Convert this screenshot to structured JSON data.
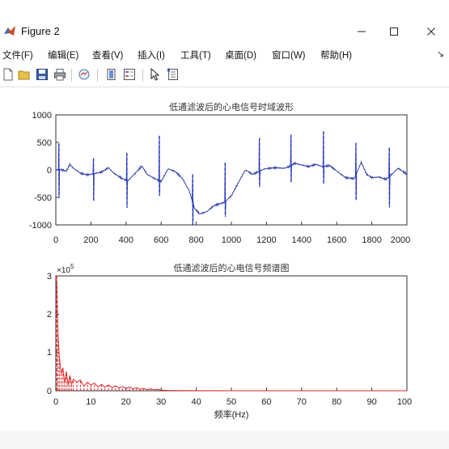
{
  "window": {
    "title": "Figure 2"
  },
  "menu": [
    "文件(F)",
    "编辑(E)",
    "查看(V)",
    "插入(I)",
    "工具(T)",
    "桌面(D)",
    "窗口(W)",
    "帮助(H)"
  ],
  "toolbar_icons": [
    "new-figure-icon",
    "open-file-icon",
    "save-icon",
    "print-icon",
    "link-plot-icon",
    "insert-colorbar-icon",
    "insert-legend-icon",
    "select-arrow-icon",
    "property-editor-icon"
  ],
  "chart_data": [
    {
      "type": "line",
      "title": "低通滤波后的心电信号时域波形",
      "xlabel": "",
      "ylabel": "",
      "xlim": [
        0,
        2000
      ],
      "ylim": [
        -1000,
        1000
      ],
      "xticks": [
        "0",
        "200",
        "400",
        "600",
        "800",
        "1000",
        "1200",
        "1400",
        "1600",
        "1800",
        "2000"
      ],
      "yticks": [
        "1000",
        "500",
        "0",
        "-500",
        "-1000"
      ],
      "baseline": [
        [
          0,
          0
        ],
        [
          20,
          10
        ],
        [
          60,
          -20
        ],
        [
          80,
          100
        ],
        [
          100,
          30
        ],
        [
          140,
          -60
        ],
        [
          180,
          -90
        ],
        [
          215,
          -70
        ],
        [
          260,
          -40
        ],
        [
          300,
          40
        ],
        [
          330,
          -60
        ],
        [
          380,
          -160
        ],
        [
          410,
          -200
        ],
        [
          450,
          -70
        ],
        [
          490,
          70
        ],
        [
          520,
          -80
        ],
        [
          570,
          -170
        ],
        [
          600,
          -210
        ],
        [
          640,
          20
        ],
        [
          680,
          -30
        ],
        [
          720,
          -150
        ],
        [
          760,
          -380
        ],
        [
          790,
          -700
        ],
        [
          820,
          -800
        ],
        [
          860,
          -760
        ],
        [
          900,
          -650
        ],
        [
          960,
          -590
        ],
        [
          1000,
          -470
        ],
        [
          1050,
          -170
        ],
        [
          1080,
          0
        ],
        [
          1120,
          -80
        ],
        [
          1150,
          -40
        ],
        [
          1190,
          20
        ],
        [
          1250,
          40
        ],
        [
          1300,
          30
        ],
        [
          1330,
          60
        ],
        [
          1360,
          120
        ],
        [
          1400,
          90
        ],
        [
          1440,
          60
        ],
        [
          1480,
          100
        ],
        [
          1520,
          60
        ],
        [
          1560,
          80
        ],
        [
          1600,
          -20
        ],
        [
          1650,
          -140
        ],
        [
          1700,
          -160
        ],
        [
          1740,
          140
        ],
        [
          1770,
          -80
        ],
        [
          1800,
          -140
        ],
        [
          1840,
          -130
        ],
        [
          1880,
          -170
        ],
        [
          1900,
          -120
        ],
        [
          1950,
          30
        ],
        [
          2000,
          -80
        ]
      ],
      "r_peaks": [
        {
          "x": 18,
          "top": 480,
          "bottom": -510
        },
        {
          "x": 215,
          "top": 210,
          "bottom": -560
        },
        {
          "x": 405,
          "top": 310,
          "bottom": -690
        },
        {
          "x": 590,
          "top": 620,
          "bottom": -470
        },
        {
          "x": 780,
          "top": -80,
          "bottom": -1000
        },
        {
          "x": 965,
          "top": 130,
          "bottom": -850
        },
        {
          "x": 1160,
          "top": 580,
          "bottom": -310
        },
        {
          "x": 1340,
          "top": 640,
          "bottom": -230
        },
        {
          "x": 1525,
          "top": 700,
          "bottom": -250
        },
        {
          "x": 1710,
          "top": 490,
          "bottom": -550
        },
        {
          "x": 1900,
          "top": 400,
          "bottom": -680
        }
      ]
    },
    {
      "type": "line",
      "title": "低通滤波后的心电信号频谱图",
      "xlabel": "频率(Hz)",
      "ylabel": "",
      "exponent_label": "×10",
      "exponent_power": "5",
      "xlim": [
        0,
        100
      ],
      "ylim": [
        0,
        300000
      ],
      "xticks": [
        "0",
        "10",
        "20",
        "30",
        "40",
        "50",
        "60",
        "70",
        "80",
        "90",
        "100"
      ],
      "yticks": [
        "3",
        "2",
        "1",
        "0"
      ],
      "spectrum": [
        [
          0,
          300000
        ],
        [
          0.3,
          280000
        ],
        [
          0.6,
          150000
        ],
        [
          1.0,
          90000
        ],
        [
          1.5,
          45000
        ],
        [
          2,
          60000
        ],
        [
          2.5,
          20000
        ],
        [
          3,
          50000
        ],
        [
          3.5,
          15000
        ],
        [
          4,
          40000
        ],
        [
          4.5,
          18000
        ],
        [
          5,
          30000
        ],
        [
          6,
          22000
        ],
        [
          7,
          28000
        ],
        [
          8,
          12000
        ],
        [
          9,
          22000
        ],
        [
          10,
          15000
        ],
        [
          11,
          20000
        ],
        [
          12,
          10000
        ],
        [
          13,
          17000
        ],
        [
          14,
          9000
        ],
        [
          15,
          15000
        ],
        [
          16,
          8000
        ],
        [
          17,
          13000
        ],
        [
          18,
          7000
        ],
        [
          19,
          11000
        ],
        [
          20,
          6000
        ],
        [
          21,
          10000
        ],
        [
          22,
          5000
        ],
        [
          23,
          8000
        ],
        [
          24,
          4000
        ],
        [
          25,
          6000
        ],
        [
          26,
          3000
        ],
        [
          27,
          5000
        ],
        [
          28,
          2500
        ],
        [
          29,
          4000
        ],
        [
          30,
          1500
        ],
        [
          32,
          800
        ],
        [
          35,
          400
        ],
        [
          40,
          200
        ],
        [
          50,
          100
        ],
        [
          60,
          80
        ],
        [
          70,
          60
        ],
        [
          80,
          50
        ],
        [
          90,
          40
        ],
        [
          100,
          30
        ]
      ]
    }
  ]
}
